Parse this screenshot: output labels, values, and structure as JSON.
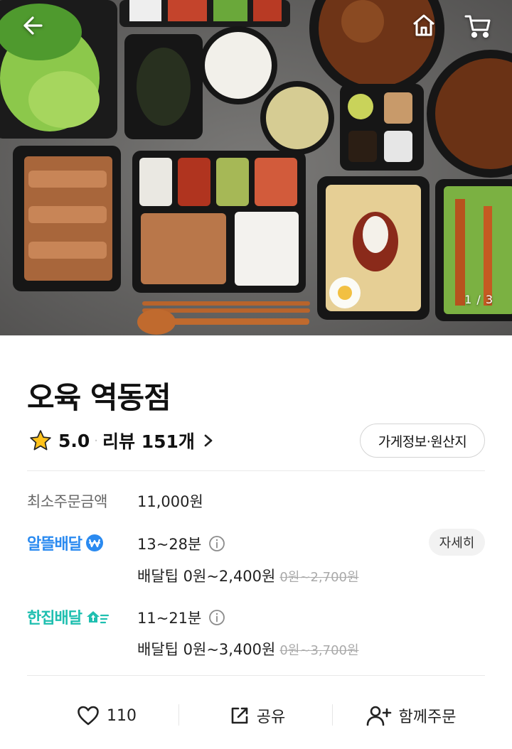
{
  "hero": {
    "counter": "1 / 3",
    "icons": {
      "back": "arrow-left-icon",
      "home": "home-icon",
      "cart": "cart-icon"
    }
  },
  "store": {
    "name": "오육 역동점",
    "rating": "5.0",
    "separator": "·",
    "reviews": "리뷰 151개",
    "info_button": "가게정보·원산지"
  },
  "min_order": {
    "label": "최소주문금액",
    "value": "11,000원"
  },
  "delivery_options": [
    {
      "brand": "알뜰배달",
      "brand_color": "#2a8af0",
      "time": "13~28분",
      "tip": "배달팁 0원~2,400원",
      "tip_original": "0원~2,700원",
      "detail_button": "자세히"
    },
    {
      "brand": "한집배달",
      "brand_color": "#1fbfb0",
      "time": "11~21분",
      "tip": "배달팁 0원~3,400원",
      "tip_original": "0원~3,700원"
    }
  ],
  "actions": {
    "like_count": "110",
    "share_label": "공유",
    "group_order_label": "함께주문"
  },
  "colors": {
    "star": "#ffc21c",
    "text": "#111111",
    "muted": "#666666"
  }
}
